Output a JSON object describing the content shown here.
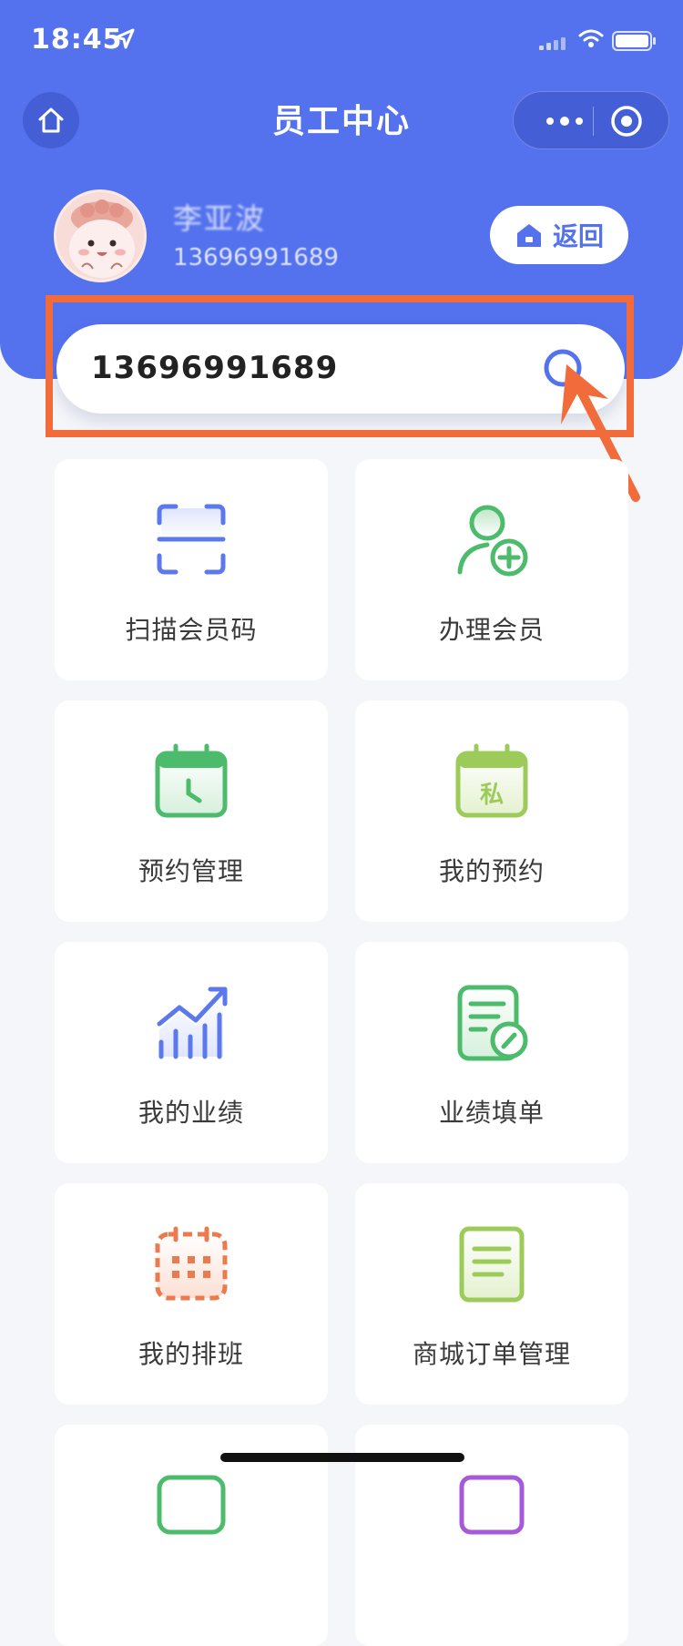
{
  "status_bar": {
    "time": "18:45"
  },
  "nav": {
    "title": "员工中心"
  },
  "user": {
    "name": "李亚波",
    "phone": "13696991689"
  },
  "back_button": {
    "label": "返回"
  },
  "search": {
    "value": "13696991689"
  },
  "menu": [
    {
      "label": "扫描会员码",
      "icon": "scan-icon"
    },
    {
      "label": "办理会员",
      "icon": "add-member-icon"
    },
    {
      "label": "预约管理",
      "icon": "calendar-clock-icon"
    },
    {
      "label": "我的预约",
      "icon": "calendar-private-icon"
    },
    {
      "label": "我的业绩",
      "icon": "performance-chart-icon"
    },
    {
      "label": "业绩填单",
      "icon": "form-edit-icon"
    },
    {
      "label": "我的排班",
      "icon": "schedule-icon"
    },
    {
      "label": "商城订单管理",
      "icon": "order-list-icon"
    },
    {
      "label": "",
      "icon": "card-icon-green"
    },
    {
      "label": "",
      "icon": "card-icon-purple"
    }
  ],
  "colors": {
    "brand": "#5472ee",
    "highlight": "#f26b3a",
    "icon_blue": "#5b78ec",
    "icon_green": "#4cbb6c",
    "icon_lime": "#9ccb5a",
    "icon_orange": "#ec7a4d",
    "icon_purple": "#a65ad8"
  }
}
